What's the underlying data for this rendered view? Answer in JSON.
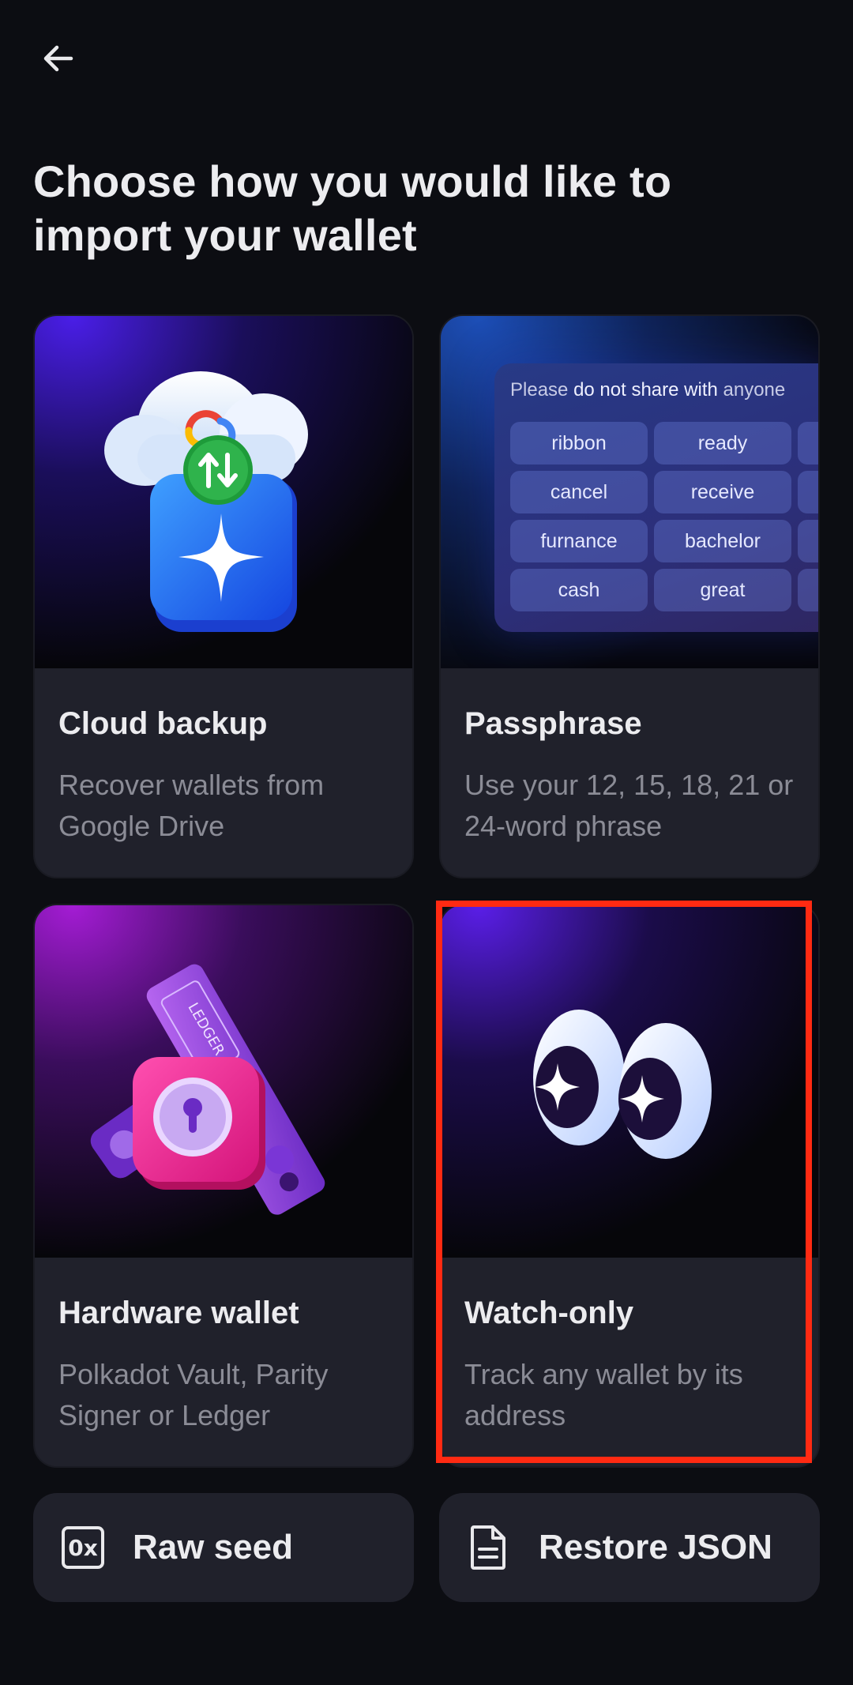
{
  "header": {
    "back_label": "",
    "title": "Choose how you would like to import your wallet"
  },
  "cards": [
    {
      "title": "Cloud backup",
      "description": "Recover wallets from Google Drive"
    },
    {
      "title": "Passphrase",
      "description": "Use your 12, 15, 18, 21 or 24-word phrase"
    },
    {
      "title": "Hardware wallet",
      "description": "Polkadot Vault, Parity Signer or Ledger"
    },
    {
      "title": "Watch-only",
      "description": "Track any wallet by its address"
    }
  ],
  "passphrase_art": {
    "heading_dim": "Please ",
    "heading_bold": "do not share with",
    "heading_tail": " anyone",
    "words": [
      "ribbon",
      "ready",
      "cancel",
      "receive",
      "furnance",
      "bachelor",
      "cash",
      "great"
    ]
  },
  "ledger_art": {
    "label": "LEDGER"
  },
  "bottom_buttons": [
    {
      "label": "Raw seed",
      "icon": "0x"
    },
    {
      "label": "Restore JSON",
      "icon": "document-icon"
    }
  ],
  "colors": {
    "background": "#0c0d12",
    "card": "#20212b",
    "highlight": "#ff2a12"
  }
}
